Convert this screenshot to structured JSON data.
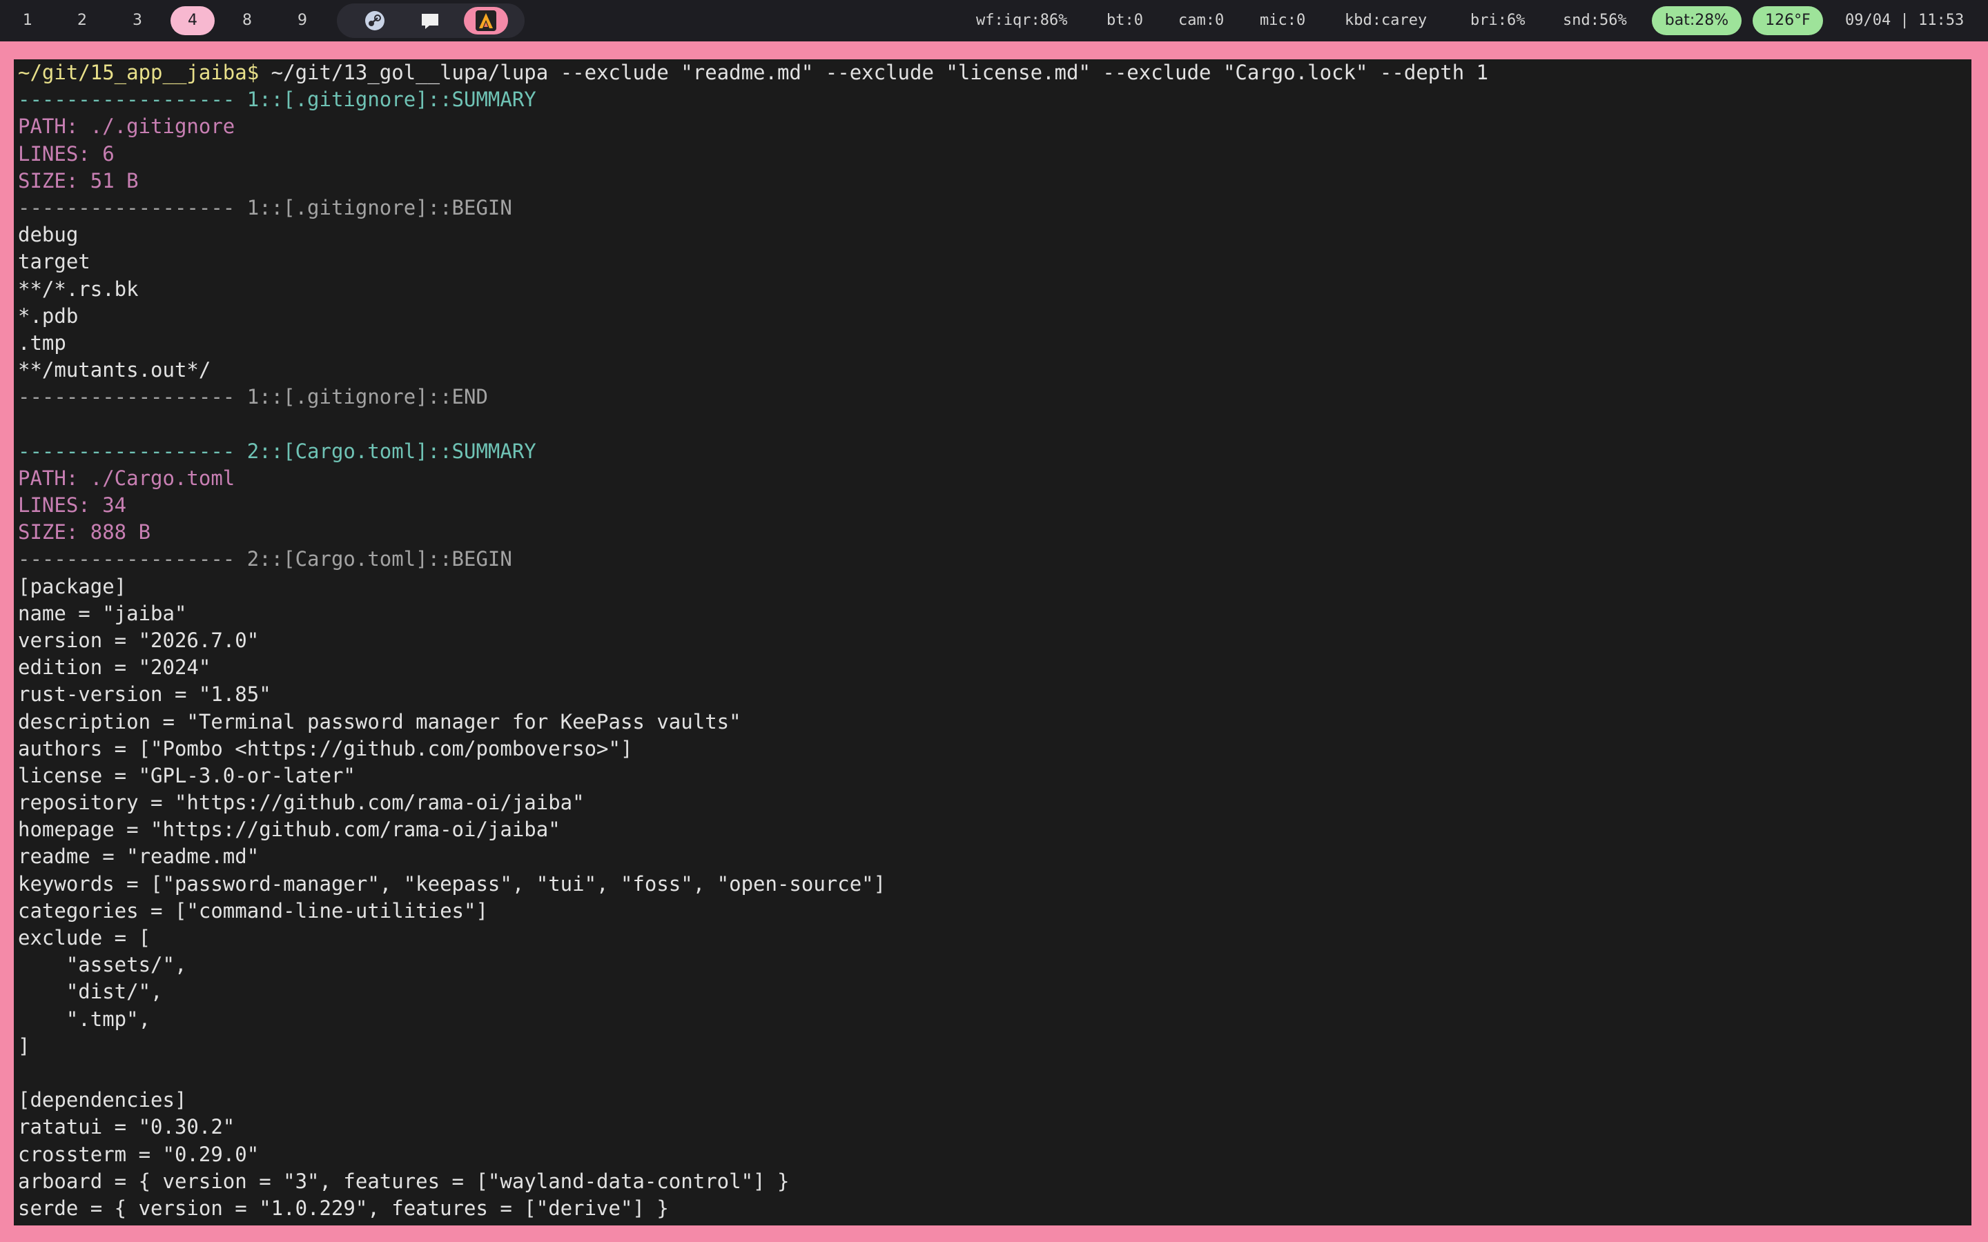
{
  "topbar": {
    "workspaces": [
      {
        "label": "1",
        "active": false
      },
      {
        "label": "2",
        "active": false
      },
      {
        "label": "3",
        "active": false
      },
      {
        "label": "4",
        "active": true
      },
      {
        "label": "8",
        "active": false
      },
      {
        "label": "9",
        "active": false
      }
    ],
    "tray_icons": [
      "steam-icon",
      "chat-icon",
      "alacritty-icon"
    ],
    "status": {
      "wifi": "wf:iqr:86%",
      "bluetooth": "bt:0",
      "camera": "cam:0",
      "mic": "mic:0",
      "keyboard": "kbd:carey",
      "brightness": "bri:6%",
      "sound": "snd:56%",
      "battery": "bat:28%",
      "temperature": "126°F",
      "datetime": "09/04 | 11:53"
    },
    "colors": {
      "bar_bg": "#1d1d22",
      "pill_green": "#9ee39a",
      "active_ws": "#f7b8d0",
      "border_pink": "#f48aa8"
    }
  },
  "terminal": {
    "prompt": "~/git/15_app__jaiba$",
    "command": " ~/git/13_gol__lupa/lupa --exclude \"readme.md\" --exclude \"license.md\" --exclude \"Cargo.lock\" --depth 1",
    "lines": [
      {
        "style": "summary",
        "text": "------------------ 1::[.gitignore]::SUMMARY"
      },
      {
        "style": "meta",
        "text": "PATH: ./.gitignore"
      },
      {
        "style": "meta",
        "text": "LINES: 6"
      },
      {
        "style": "meta",
        "text": "SIZE: 51 B"
      },
      {
        "style": "sep",
        "text": "------------------ 1::[.gitignore]::BEGIN"
      },
      {
        "style": "text",
        "text": "debug"
      },
      {
        "style": "text",
        "text": "target"
      },
      {
        "style": "text",
        "text": "**/*.rs.bk"
      },
      {
        "style": "text",
        "text": "*.pdb"
      },
      {
        "style": "text",
        "text": ".tmp"
      },
      {
        "style": "text",
        "text": "**/mutants.out*/"
      },
      {
        "style": "sep",
        "text": "------------------ 1::[.gitignore]::END"
      },
      {
        "style": "text",
        "text": ""
      },
      {
        "style": "summary",
        "text": "------------------ 2::[Cargo.toml]::SUMMARY"
      },
      {
        "style": "meta",
        "text": "PATH: ./Cargo.toml"
      },
      {
        "style": "meta",
        "text": "LINES: 34"
      },
      {
        "style": "meta",
        "text": "SIZE: 888 B"
      },
      {
        "style": "sep",
        "text": "------------------ 2::[Cargo.toml]::BEGIN"
      },
      {
        "style": "text",
        "text": "[package]"
      },
      {
        "style": "text",
        "text": "name = \"jaiba\""
      },
      {
        "style": "text",
        "text": "version = \"2026.7.0\""
      },
      {
        "style": "text",
        "text": "edition = \"2024\""
      },
      {
        "style": "text",
        "text": "rust-version = \"1.85\""
      },
      {
        "style": "text",
        "text": "description = \"Terminal password manager for KeePass vaults\""
      },
      {
        "style": "text",
        "text": "authors = [\"Pombo <https://github.com/pomboverso>\"]"
      },
      {
        "style": "text",
        "text": "license = \"GPL-3.0-or-later\""
      },
      {
        "style": "text",
        "text": "repository = \"https://github.com/rama-oi/jaiba\""
      },
      {
        "style": "text",
        "text": "homepage = \"https://github.com/rama-oi/jaiba\""
      },
      {
        "style": "text",
        "text": "readme = \"readme.md\""
      },
      {
        "style": "text",
        "text": "keywords = [\"password-manager\", \"keepass\", \"tui\", \"foss\", \"open-source\"]"
      },
      {
        "style": "text",
        "text": "categories = [\"command-line-utilities\"]"
      },
      {
        "style": "text",
        "text": "exclude = ["
      },
      {
        "style": "text",
        "text": "    \"assets/\","
      },
      {
        "style": "text",
        "text": "    \"dist/\","
      },
      {
        "style": "text",
        "text": "    \".tmp\","
      },
      {
        "style": "text",
        "text": "]"
      },
      {
        "style": "text",
        "text": ""
      },
      {
        "style": "text",
        "text": "[dependencies]"
      },
      {
        "style": "text",
        "text": "ratatui = \"0.30.2\""
      },
      {
        "style": "text",
        "text": "crossterm = \"0.29.0\""
      },
      {
        "style": "text",
        "text": "arboard = { version = \"3\", features = [\"wayland-data-control\"] }"
      },
      {
        "style": "text",
        "text": "serde = { version = \"1.0.229\", features = [\"derive\"] }"
      }
    ]
  }
}
